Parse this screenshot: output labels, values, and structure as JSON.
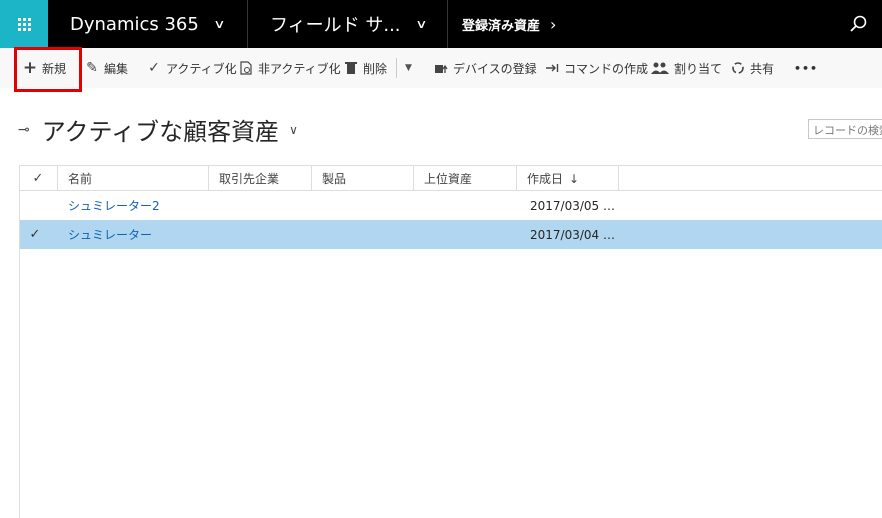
{
  "nav": {
    "app": "Dynamics 365",
    "area": "フィールド サ...",
    "breadcrumb": "登録済み資産"
  },
  "commands": {
    "new": "新規",
    "edit": "編集",
    "activate": "アクティブ化",
    "deactivate": "非アクティブ化",
    "delete": "削除",
    "register_devices": "デバイスの登録",
    "create_command": "コマンドの作成",
    "assign": "割り当て",
    "share": "共有",
    "more": "•••"
  },
  "view": {
    "title": "アクティブな顧客資産",
    "search_placeholder": "レコードの検索"
  },
  "grid": {
    "columns": [
      "名前",
      "取引先企業",
      "製品",
      "上位資産",
      "作成日"
    ],
    "rows": [
      {
        "name": "シュミレーター2",
        "account": "",
        "product": "",
        "parent": "",
        "created": "2017/03/05 …",
        "selected": false
      },
      {
        "name": "シュミレーター",
        "account": "",
        "product": "",
        "parent": "",
        "created": "2017/03/04 …",
        "selected": true
      }
    ]
  },
  "colors": {
    "nav_bg": "#000000",
    "waffle_bg": "#1bb5c7",
    "selected_row": "#b1d6f0",
    "link": "#1160b7",
    "highlight": "#e30000"
  }
}
